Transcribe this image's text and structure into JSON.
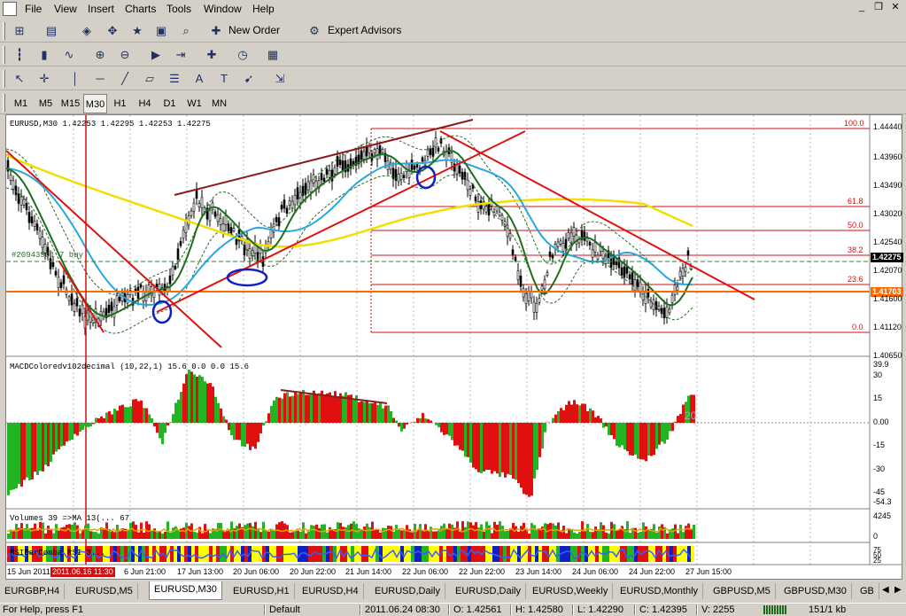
{
  "menu": [
    "File",
    "View",
    "Insert",
    "Charts",
    "Tools",
    "Window",
    "Help"
  ],
  "toolbar": {
    "new_order": "New Order",
    "expert_advisors": "Expert Advisors",
    "timeframes": [
      "M1",
      "M5",
      "M15",
      "M30",
      "H1",
      "H4",
      "D1",
      "W1",
      "MN"
    ],
    "active_timeframe": "M30"
  },
  "chart": {
    "header": "EURUSD,M30  1.42253 1.42295 1.42253 1.42275",
    "order_label": "#20943901 7 buy",
    "price_axis": [
      "1.44440",
      "1.43960",
      "1.43490",
      "1.43020",
      "1.42540",
      "1.42275",
      "1.42070",
      "1.41703",
      "1.41600",
      "1.41120",
      "1.40650"
    ],
    "current_price": "1.42275",
    "hline_price": "1.41703",
    "fib_levels": [
      "100.0",
      "61.8",
      "50.0",
      "38.2",
      "23.6",
      "0.0"
    ],
    "macd_title": "MACDColoredv102decimal (10,22,1) 15.6 0.0 0.0 15.6",
    "macd_axis": [
      "39.9",
      "30",
      "15",
      "0.00",
      "-15",
      "-30",
      "-45",
      "-54.3"
    ],
    "macd_level_label": "20",
    "volume_title": "Volumes 39  =>MA 13(... 67",
    "volume_axis": [
      "4245",
      "0"
    ],
    "rsi_title": "RSIBarComba  RSI 3...",
    "rsi_axis": [
      "75",
      "50",
      "25"
    ],
    "time_axis": [
      "15 Jun 2011",
      "2011.06.16 11:30",
      "6 Jun 21:00",
      "17 Jun 13:00",
      "20 Jun 06:00",
      "20 Jun 22:00",
      "21 Jun 14:00",
      "22 Jun 06:00",
      "22 Jun 22:00",
      "23 Jun 14:00",
      "24 Jun 06:00",
      "24 Jun 22:00",
      "27 Jun 15:00"
    ]
  },
  "tabs": [
    "EURGBP,H4",
    "EURUSD,M5",
    "EURUSD,M30",
    "EURUSD,H1",
    "EURUSD,H4",
    "EURUSD,Daily",
    "EURUSD,Daily",
    "EURUSD,Weekly",
    "EURUSD,Monthly",
    "GBPUSD,M5",
    "GBPUSD,M30",
    "GB"
  ],
  "active_tab": "EURUSD,M30",
  "status": {
    "help": "For Help, press F1",
    "profile": "Default",
    "time": "2011.06.24 08:30",
    "open": "O: 1.42561",
    "high": "H: 1.42580",
    "low": "L: 1.42290",
    "close": "C: 1.42395",
    "volume": "V: 2255",
    "traffic": "151/1 kb"
  },
  "colors": {
    "bull": "#22b422",
    "bear": "#e01010",
    "ma_fast": "#1e6e1e",
    "ma_mid": "#28a8e0",
    "ma_slow": "#f0e000",
    "trend": "#e01010",
    "resist": "#8b1a1a",
    "hline": "#ff6a00",
    "circle": "#1020c0"
  }
}
